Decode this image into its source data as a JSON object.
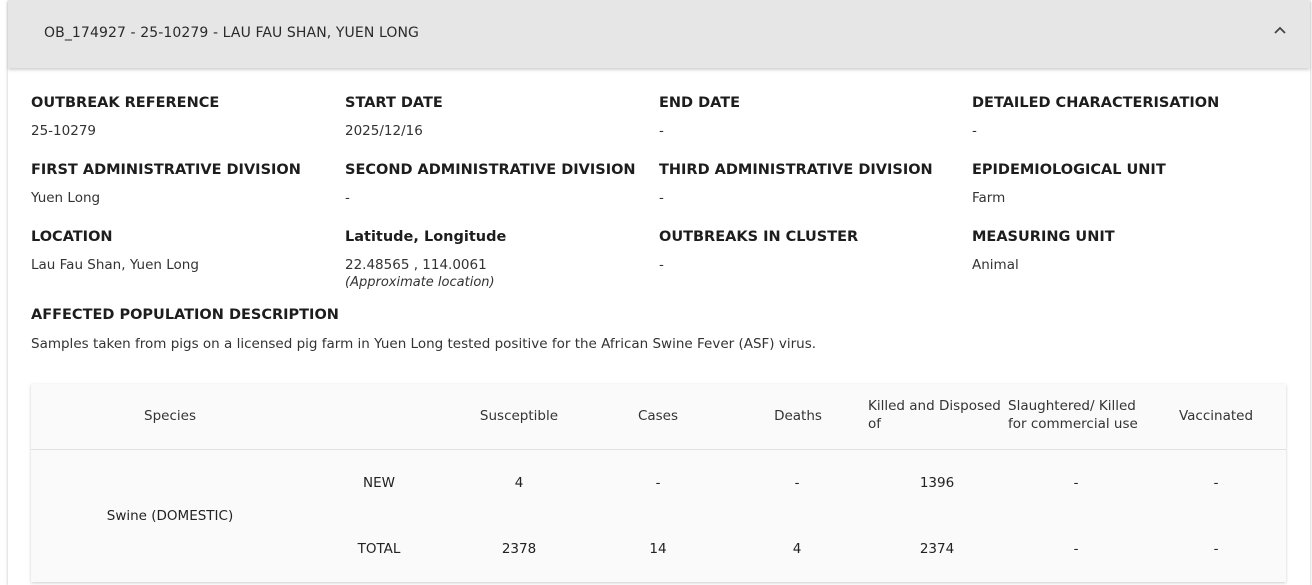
{
  "header": {
    "title": "OB_174927 - 25-10279 - LAU FAU SHAN, YUEN LONG"
  },
  "fields": {
    "outbreak_reference": {
      "label": "OUTBREAK REFERENCE",
      "value": "25-10279"
    },
    "start_date": {
      "label": "START DATE",
      "value": "2025/12/16"
    },
    "end_date": {
      "label": "END DATE",
      "value": "-"
    },
    "detailed_characterisation": {
      "label": "DETAILED CHARACTERISATION",
      "value": "-"
    },
    "first_admin": {
      "label": "FIRST ADMINISTRATIVE DIVISION",
      "value": "Yuen Long"
    },
    "second_admin": {
      "label": "SECOND ADMINISTRATIVE DIVISION",
      "value": "-"
    },
    "third_admin": {
      "label": "THIRD ADMINISTRATIVE DIVISION",
      "value": "-"
    },
    "epi_unit": {
      "label": "EPIDEMIOLOGICAL UNIT",
      "value": "Farm"
    },
    "location": {
      "label": "LOCATION",
      "value": "Lau Fau Shan, Yuen Long"
    },
    "latlng": {
      "label": "Latitude, Longitude",
      "value": "22.48565 , 114.0061",
      "note": "(Approximate location)"
    },
    "outbreaks_cluster": {
      "label": "OUTBREAKS IN CLUSTER",
      "value": "-"
    },
    "measuring_unit": {
      "label": "MEASURING UNIT",
      "value": "Animal"
    }
  },
  "affected_population": {
    "label": "AFFECTED POPULATION DESCRIPTION",
    "value": "Samples taken from pigs on a licensed pig farm in Yuen Long tested positive for the African Swine Fever (ASF) virus."
  },
  "table": {
    "headers": {
      "species": "Species",
      "susceptible": "Susceptible",
      "cases": "Cases",
      "deaths": "Deaths",
      "killed_line1": "Killed and Disposed",
      "killed_line2": "of",
      "slaughtered_line1": "Slaughtered/ Killed",
      "slaughtered_line2": "for commercial use",
      "vaccinated": "Vaccinated"
    },
    "species": "Swine (DOMESTIC)",
    "rows": [
      {
        "type": "NEW",
        "susceptible": "4",
        "cases": "-",
        "deaths": "-",
        "killed": "1396",
        "slaughtered": "-",
        "vaccinated": "-"
      },
      {
        "type": "TOTAL",
        "susceptible": "2378",
        "cases": "14",
        "deaths": "4",
        "killed": "2374",
        "slaughtered": "-",
        "vaccinated": "-"
      }
    ]
  },
  "icons": {
    "collapse": "chevron-up-icon"
  }
}
